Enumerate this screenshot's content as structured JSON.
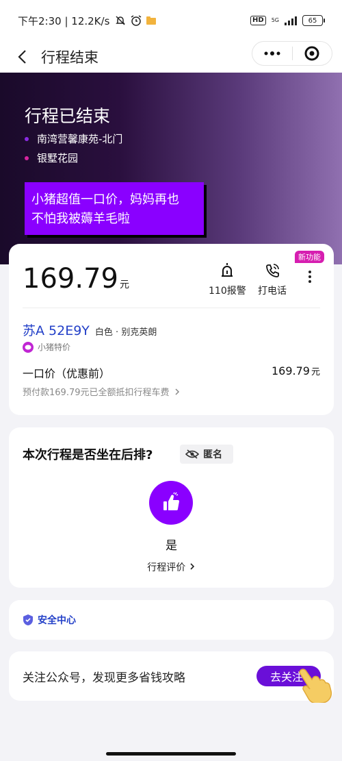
{
  "status_bar": {
    "time_speed": "下午2:30 | 12.2K/s",
    "hd": "HD",
    "network": "5G",
    "battery": "65"
  },
  "nav": {
    "title": "行程结束"
  },
  "hero": {
    "title": "行程已结束",
    "from": "南湾营馨康苑-北门",
    "to": "银墅花园",
    "from_color": "#8a2be2",
    "to_color": "#d6249f",
    "promo_line1": "小猪超值一口价，妈妈再也",
    "promo_line2": "不怕我被薅羊毛啦"
  },
  "fare": {
    "price": "169.79",
    "price_unit": "元",
    "police_label": "110报警",
    "call_label": "打电话",
    "new_badge": "新功能",
    "plate": "苏A 52E9Y",
    "car_desc": "白色 · 别克英朗",
    "tag": "小猪特价",
    "fixed_label": "一口价（优惠前）",
    "fixed_value": "169.79",
    "fixed_unit": "元",
    "prepaid": "预付款169.79元已全额抵扣行程车费"
  },
  "rear": {
    "question": "本次行程是否坐在后排?",
    "anon": "匿名",
    "yes": "是",
    "rate": "行程评价"
  },
  "safety": {
    "label": "安全中心"
  },
  "follow": {
    "text": "关注公众号，发现更多省钱攻略",
    "button": "去关注"
  },
  "colors": {
    "accent": "#8a00ff",
    "link": "#2340c8",
    "badge": "#d61eb0"
  }
}
